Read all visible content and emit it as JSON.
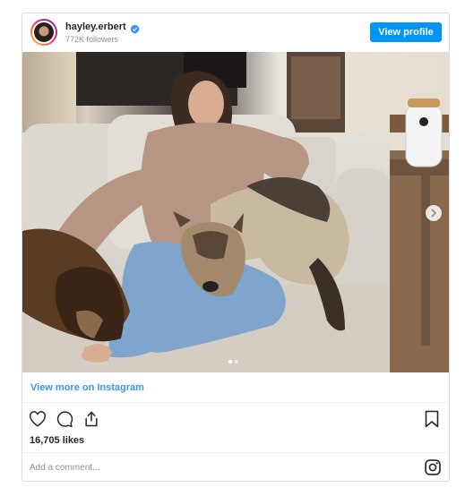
{
  "header": {
    "username": "hayley.erbert",
    "followers": "772K followers",
    "view_profile_label": "View profile",
    "verified_icon": "verified-badge-icon"
  },
  "photo": {
    "description_icon": "post-photo",
    "carousel": {
      "current": 1,
      "total": 2
    }
  },
  "footer": {
    "view_more": "View more on Instagram",
    "likes": "16,705 likes",
    "comment_placeholder": "Add a comment...",
    "icons": [
      "heart-icon",
      "comment-icon",
      "share-icon",
      "bookmark-icon",
      "instagram-icon"
    ]
  },
  "colors": {
    "accent": "#0095f6",
    "link": "#3897f0",
    "muted": "#8e8e8e",
    "border": "#dbdbdb"
  }
}
